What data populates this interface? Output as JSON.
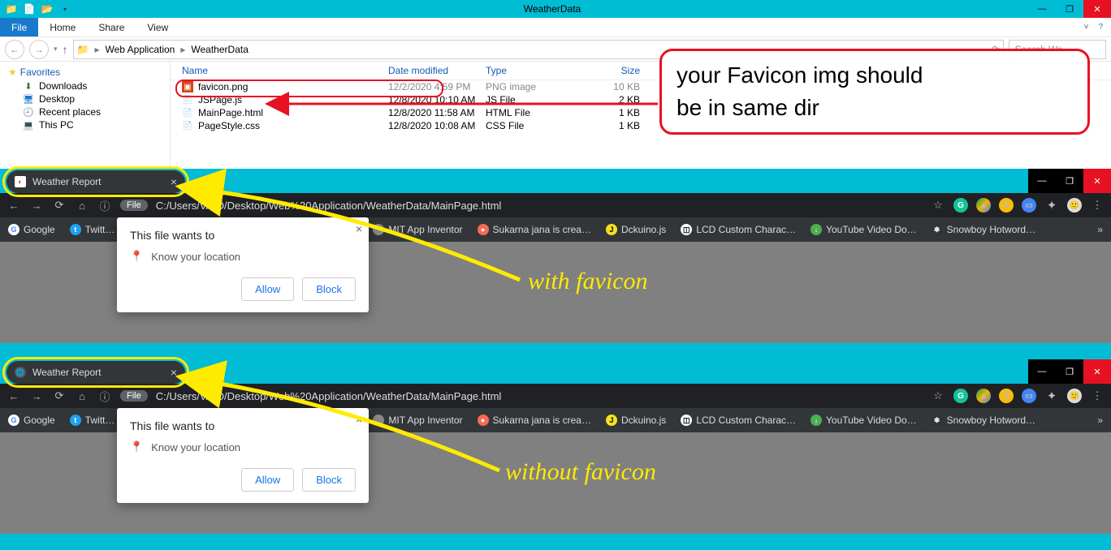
{
  "explorer": {
    "title": "WeatherData",
    "ribbon": {
      "file": "File",
      "home": "Home",
      "share": "Share",
      "view": "View"
    },
    "breadcrumb": [
      "Web Application",
      "WeatherData"
    ],
    "search_placeholder": "Search We…",
    "sidebar": {
      "favorites": "Favorites",
      "items": [
        "Downloads",
        "Desktop",
        "Recent places",
        "This PC"
      ]
    },
    "columns": {
      "name": "Name",
      "date": "Date modified",
      "type": "Type",
      "size": "Size"
    },
    "files": [
      {
        "name": "favicon.png",
        "date": "12/2/2020 4:59 PM",
        "type": "PNG image",
        "size": "10 KB"
      },
      {
        "name": "JSPage.js",
        "date": "12/8/2020 10:10 AM",
        "type": "JS File",
        "size": "2 KB"
      },
      {
        "name": "MainPage.html",
        "date": "12/8/2020 11:58 AM",
        "type": "HTML File",
        "size": "1 KB"
      },
      {
        "name": "PageStyle.css",
        "date": "12/8/2020 10:08 AM",
        "type": "CSS File",
        "size": "1 KB"
      }
    ]
  },
  "browser": {
    "tab_title": "Weather Report",
    "url": "C:/Users/VAIO/Desktop/Web%20Application/WeatherData/MainPage.html",
    "file_chip": "File",
    "bookmarks": [
      "Google",
      "Twitt…",
      "MIT App Inventor",
      "Sukarna jana is crea…",
      "Dckuino.js",
      "LCD Custom Charac…",
      "YouTube Video Do…",
      "Snowboy Hotword…"
    ],
    "perm": {
      "title": "This file wants to",
      "row": "Know your location",
      "allow": "Allow",
      "block": "Block"
    }
  },
  "annotations": {
    "note1_l1": "your Favicon img should",
    "note1_l2": "be in same dir",
    "label_with": "with favicon",
    "label_without": "without favicon"
  }
}
